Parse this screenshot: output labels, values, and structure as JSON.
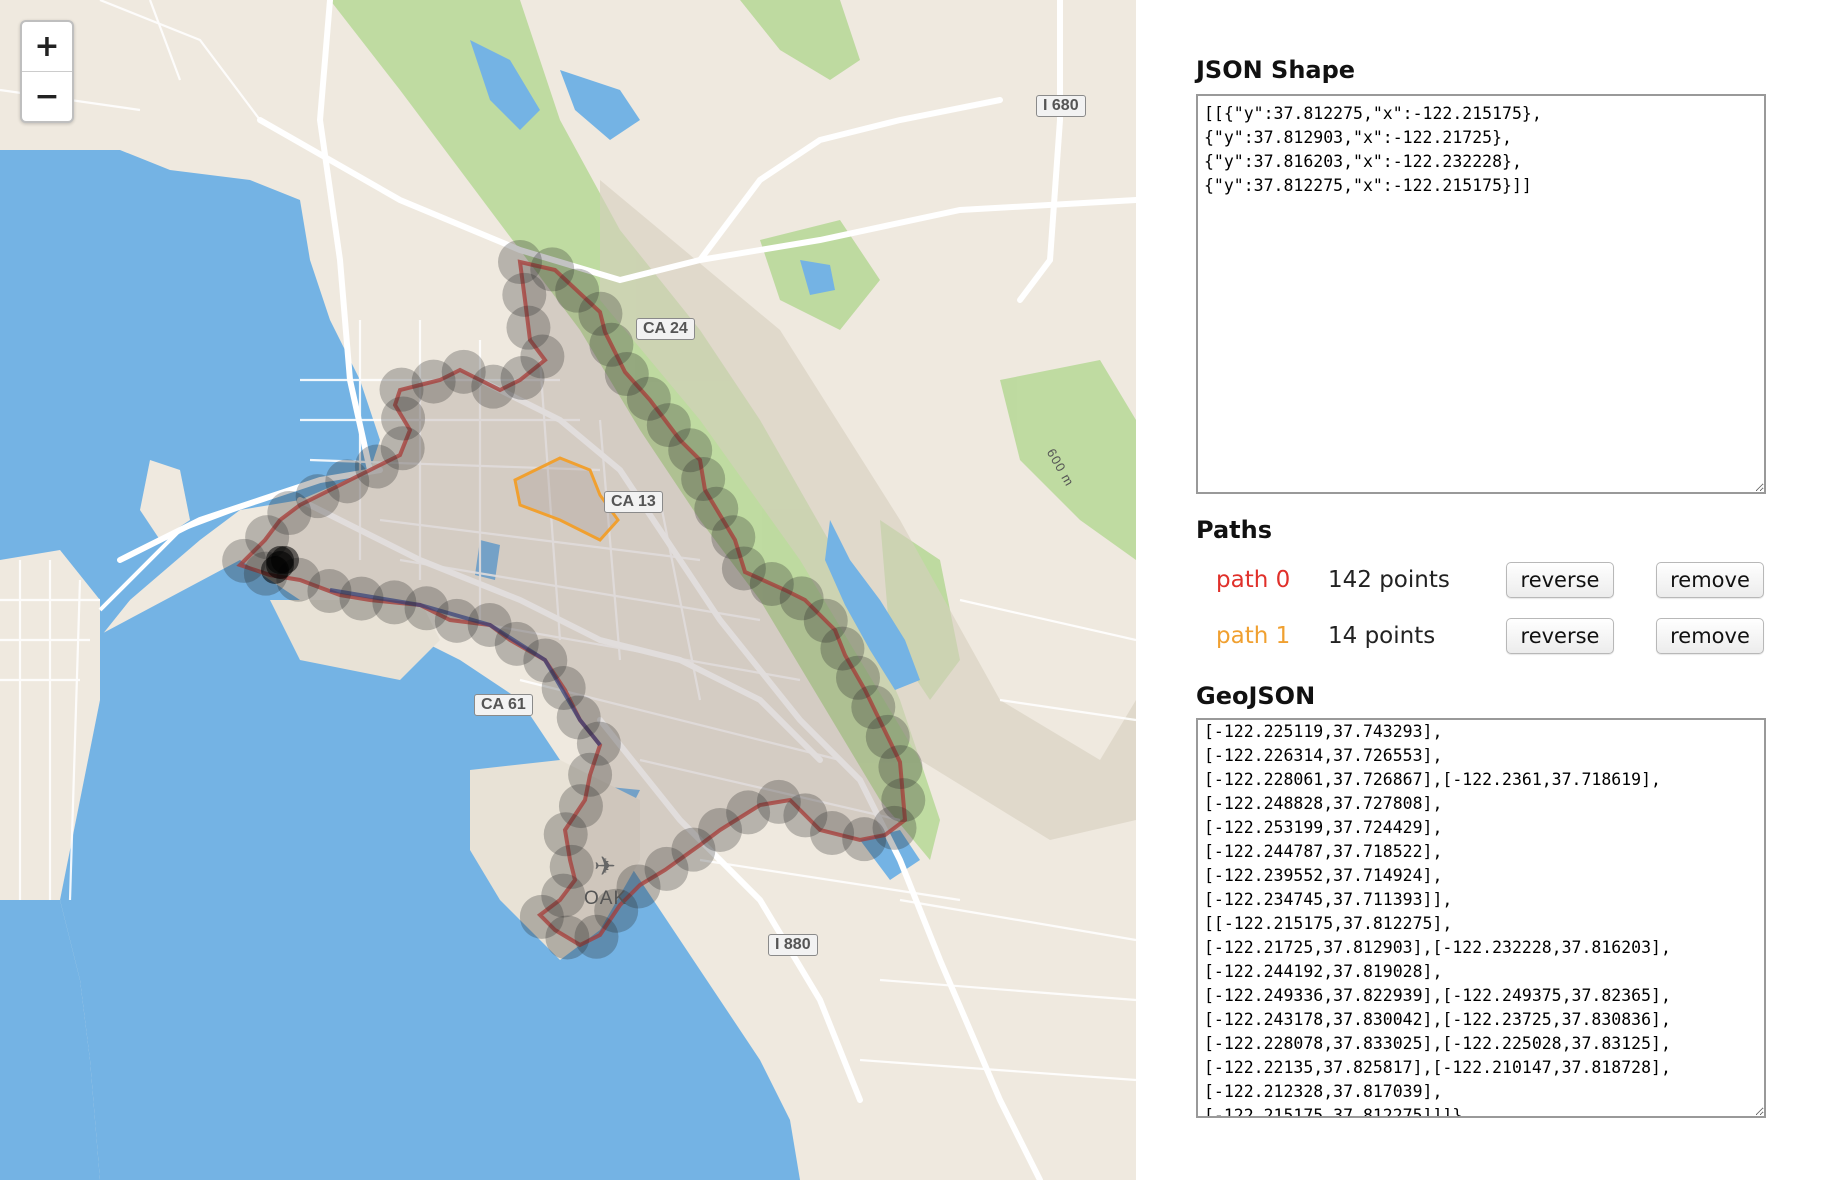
{
  "map": {
    "zoom_in_label": "+",
    "zoom_out_label": "−",
    "road_labels": [
      "I 680",
      "CA 24",
      "CA 13",
      "CA 61",
      "I 880"
    ],
    "airport_label": "OAK",
    "contour_label": "600 m",
    "colors": {
      "water": "#74b3e4",
      "land": "#efe9df",
      "park": "#b9d99a",
      "path0": "#e0302a",
      "path1": "#f0a030"
    }
  },
  "json_shape": {
    "heading": "JSON Shape",
    "value": "[[{\"y\":37.812275,\"x\":-122.215175},\n{\"y\":37.812903,\"x\":-122.21725},\n{\"y\":37.816203,\"x\":-122.232228},\n{\"y\":37.812275,\"x\":-122.215175}]]"
  },
  "paths": {
    "heading": "Paths",
    "items": [
      {
        "name": "path 0",
        "count": "142 points",
        "color": "#e0302a",
        "reverse_label": "reverse",
        "remove_label": "remove"
      },
      {
        "name": "path 1",
        "count": "14 points",
        "color": "#f0a030",
        "reverse_label": "reverse",
        "remove_label": "remove"
      }
    ]
  },
  "geojson": {
    "heading": "GeoJSON",
    "value": "[-122.225119,37.743293],\n[-122.226314,37.726553],\n[-122.228061,37.726867],[-122.2361,37.718619],\n[-122.248828,37.727808],\n[-122.253199,37.724429],\n[-122.244787,37.718522],\n[-122.239552,37.714924],\n[-122.234745,37.711393]],\n[[-122.215175,37.812275],\n[-122.21725,37.812903],[-122.232228,37.816203],\n[-122.244192,37.819028],\n[-122.249336,37.822939],[-122.249375,37.82365],\n[-122.243178,37.830042],[-122.23725,37.830836],\n[-122.228078,37.833025],[-122.225028,37.83125],\n[-122.22135,37.825817],[-122.210147,37.818728],\n[-122.212328,37.817039],\n[-122.215175,37.812275]]]}"
  }
}
